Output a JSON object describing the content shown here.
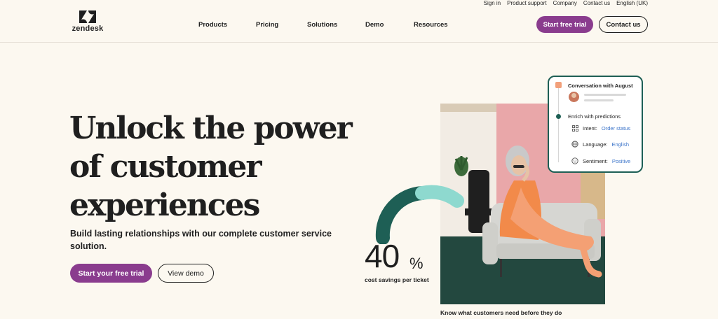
{
  "utility_nav": [
    "Sign in",
    "Product support",
    "Company",
    "Contact us",
    "English (UK)"
  ],
  "brand": {
    "name": "zendesk"
  },
  "nav": {
    "items": [
      "Products",
      "Pricing",
      "Solutions",
      "Demo",
      "Resources"
    ]
  },
  "header_actions": {
    "trial": "Start free trial",
    "contact": "Contact us"
  },
  "hero": {
    "headline": [
      "Unlock the power",
      "of customer",
      "experiences"
    ],
    "subhead": "Build lasting relationships with our complete customer service solution.",
    "cta_primary": "Start your free trial",
    "cta_secondary": "View demo"
  },
  "stat": {
    "value": "40",
    "unit": "%",
    "label": "cost savings per ticket"
  },
  "caption": "Know what customers need before they do",
  "card": {
    "title": "Conversation with August",
    "step": "Enrich with predictions",
    "rows": [
      {
        "icon": "grid-icon",
        "label": "Intent:",
        "value": "Order status"
      },
      {
        "icon": "globe-icon",
        "label": "Language:",
        "value": "English"
      },
      {
        "icon": "smiley-icon",
        "label": "Sentiment:",
        "value": "Positive"
      }
    ]
  },
  "colors": {
    "brand_purple": "#8a3c8e",
    "teal_dark": "#1e5f55",
    "teal_light": "#8ed9cf",
    "background": "#fcf8f0",
    "link_blue": "#3a73c9"
  }
}
